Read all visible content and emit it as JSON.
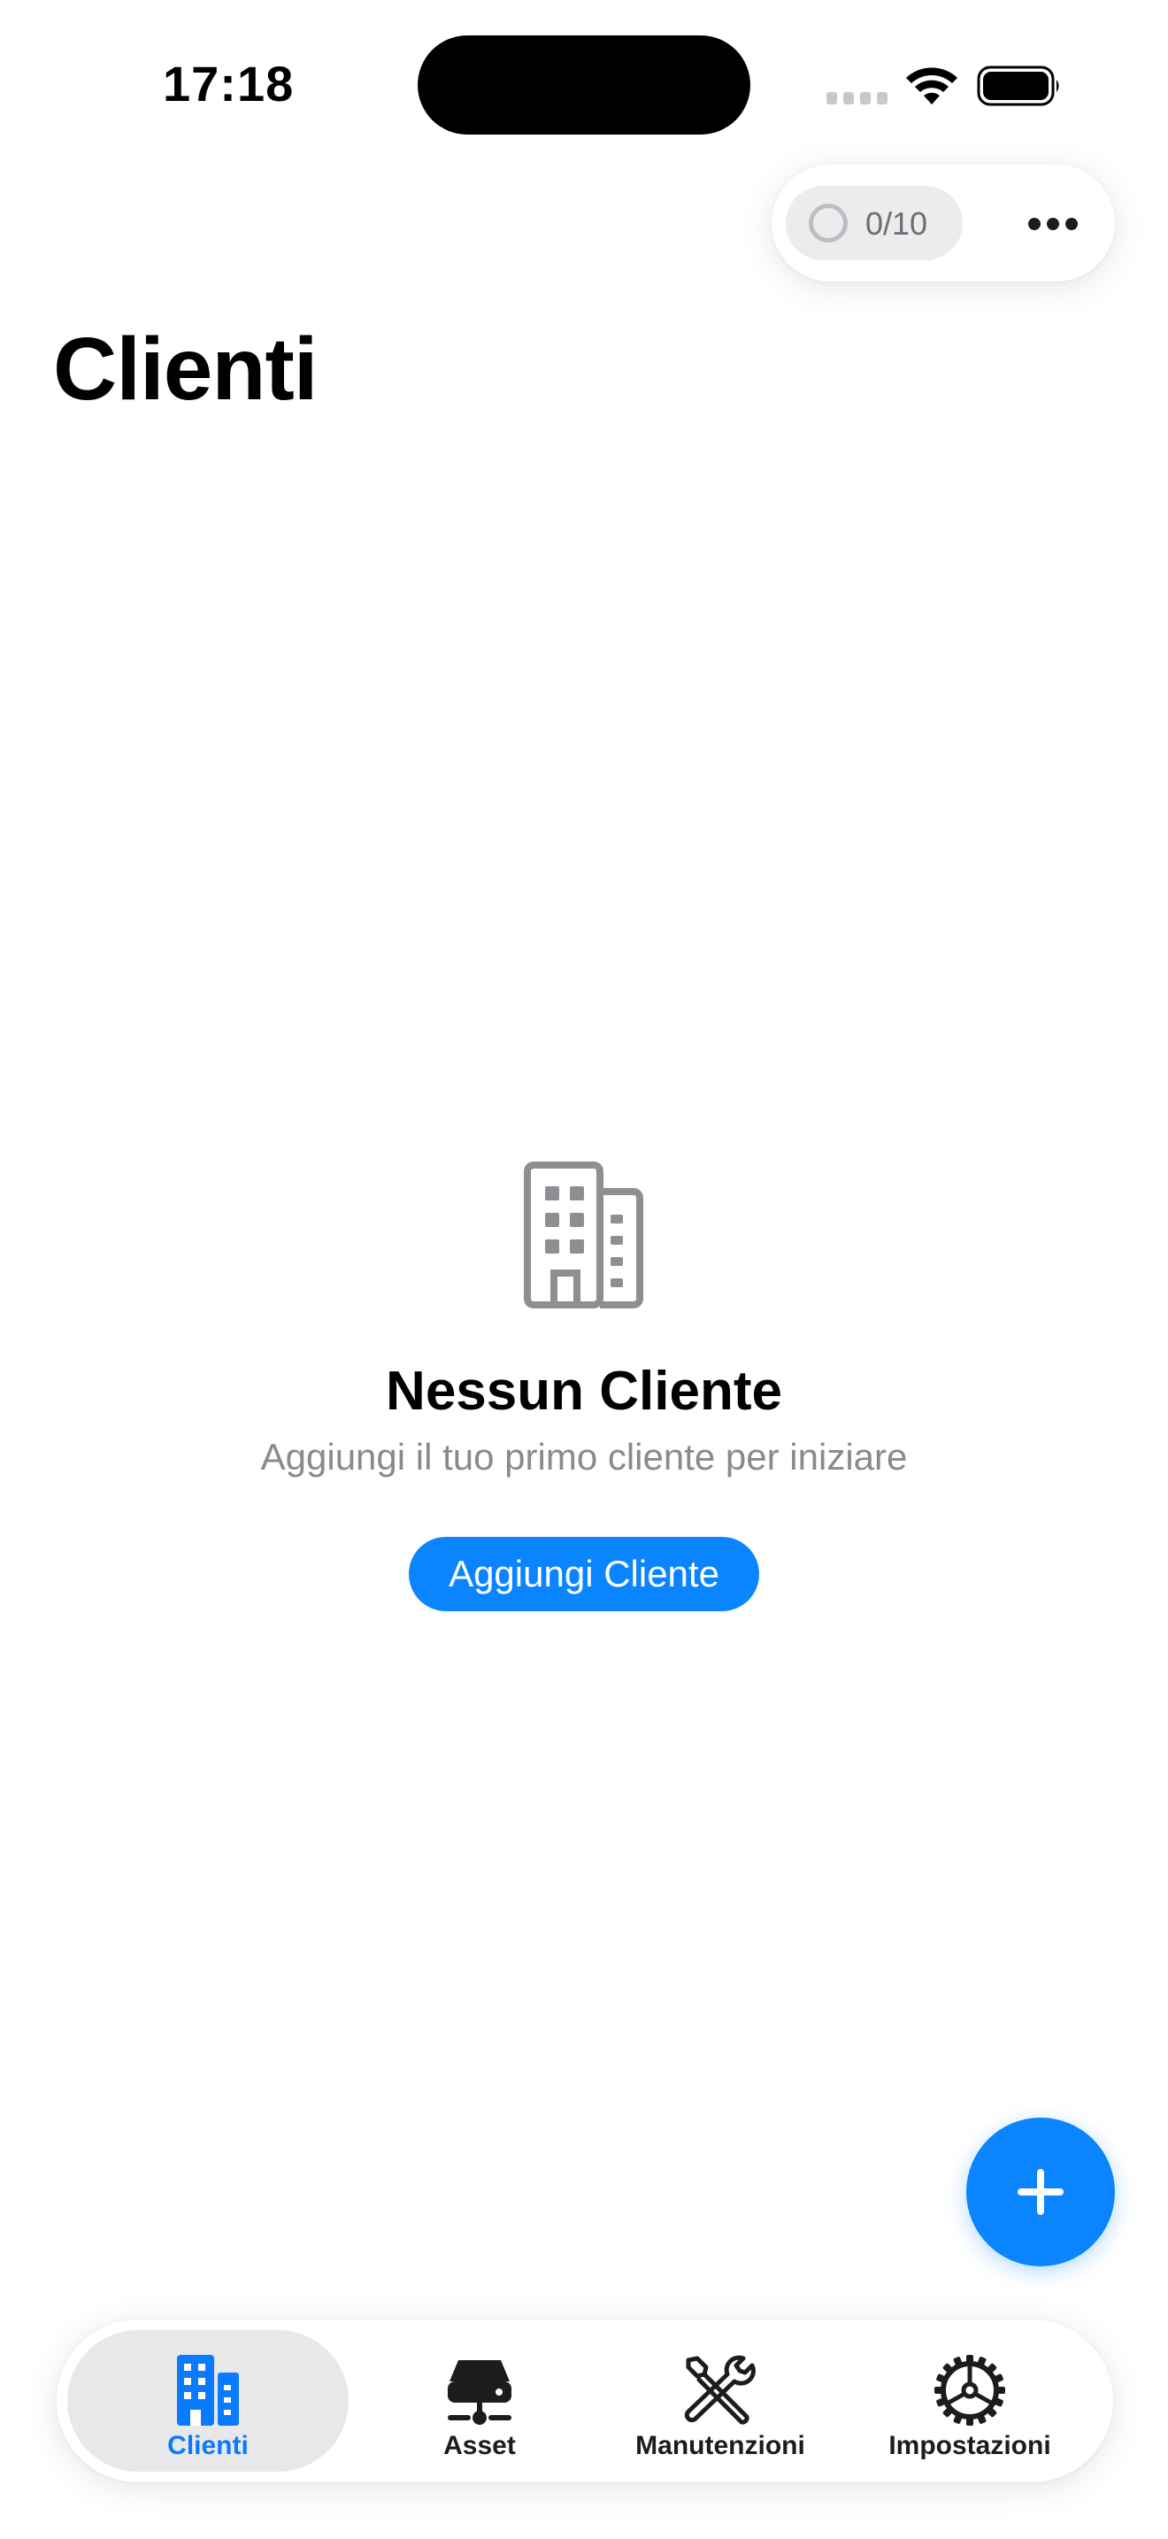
{
  "status_bar": {
    "time": "17:18"
  },
  "toolbar": {
    "progress_label": "0/10",
    "progress_icon": "progress-ring-icon",
    "more_icon": "ellipsis-icon"
  },
  "page": {
    "title": "Clienti"
  },
  "empty_state": {
    "icon": "building-icon",
    "title": "Nessun Cliente",
    "subtitle": "Aggiungi il tuo primo cliente per iniziare",
    "button_label": "Aggiungi Cliente"
  },
  "fab": {
    "icon": "plus-icon"
  },
  "tab_bar": {
    "tabs": [
      {
        "label": "Clienti",
        "icon": "building-icon",
        "selected": true
      },
      {
        "label": "Asset",
        "icon": "server-icon",
        "selected": false
      },
      {
        "label": "Manutenzioni",
        "icon": "wrench-screwdriver-icon",
        "selected": false
      },
      {
        "label": "Impostazioni",
        "icon": "gear-icon",
        "selected": false
      }
    ]
  },
  "colors": {
    "accent": "#0a84ff",
    "secondary_text": "#8a8a8e",
    "icon_gray": "#8e8e93"
  }
}
